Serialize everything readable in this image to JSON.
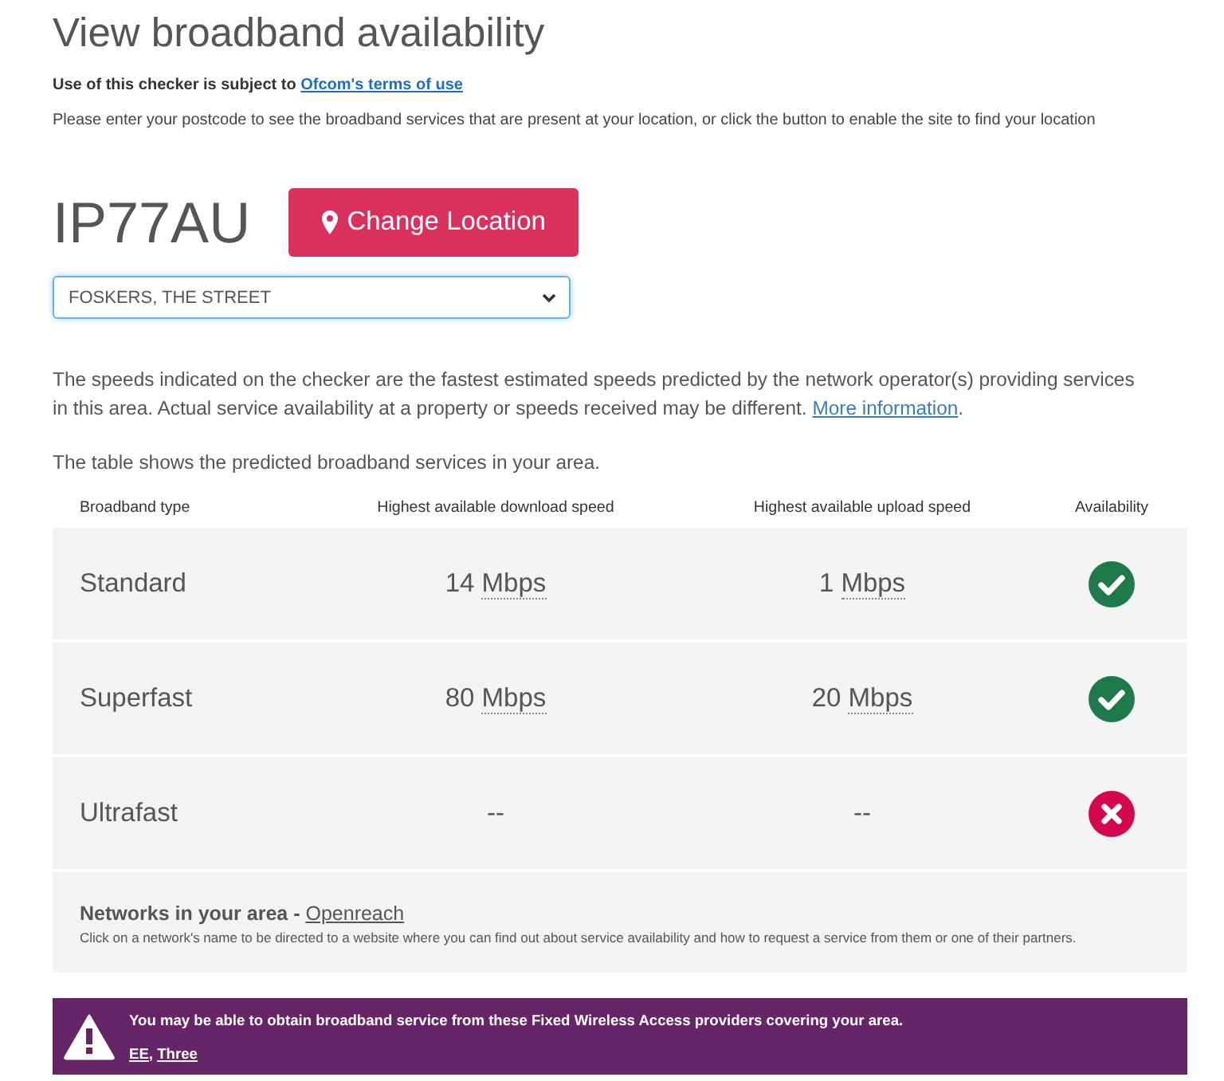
{
  "page": {
    "title": "View broadband availability"
  },
  "terms": {
    "text": "Use of this checker is subject to",
    "link": "Ofcom's terms of use"
  },
  "instruction": "Please enter your postcode to see the broadband services that are present at your location, or click the button to enable the site to find your location",
  "location": {
    "postcode": "IP77AU",
    "button": "Change Location",
    "address": "FOSKERS, THE STREET"
  },
  "disclaimer": {
    "text": "The speeds indicated on the checker are the fastest estimated speeds predicted by the network operator(s) providing services in this area. Actual service availability at a property or speeds received may be different.",
    "link": "More information",
    "text_after": "."
  },
  "table_intro": "The table shows the predicted broadband services in your area.",
  "table": {
    "columns": [
      "Broadband type",
      "Highest available download speed",
      "Highest available upload speed",
      "Availability"
    ],
    "rows": [
      {
        "type": "Standard",
        "download": "14 Mbps",
        "upload": "1 Mbps",
        "available": true
      },
      {
        "type": "Superfast",
        "download": "80 Mbps",
        "upload": "20 Mbps",
        "available": true
      },
      {
        "type": "Ultrafast",
        "download": "--",
        "upload": "--",
        "available": false
      }
    ]
  },
  "networks": {
    "label": "Networks in your area -",
    "link": "Openreach",
    "note": "Click on a network's name to be directed to a website where you can find out about service availability and how to request a service from them or one of their partners."
  },
  "fixed_wireless": {
    "message": "You may be able to obtain broadband service from these Fixed Wireless Access providers covering your area.",
    "providers": [
      "EE",
      "Three"
    ],
    "separator": ","
  }
}
